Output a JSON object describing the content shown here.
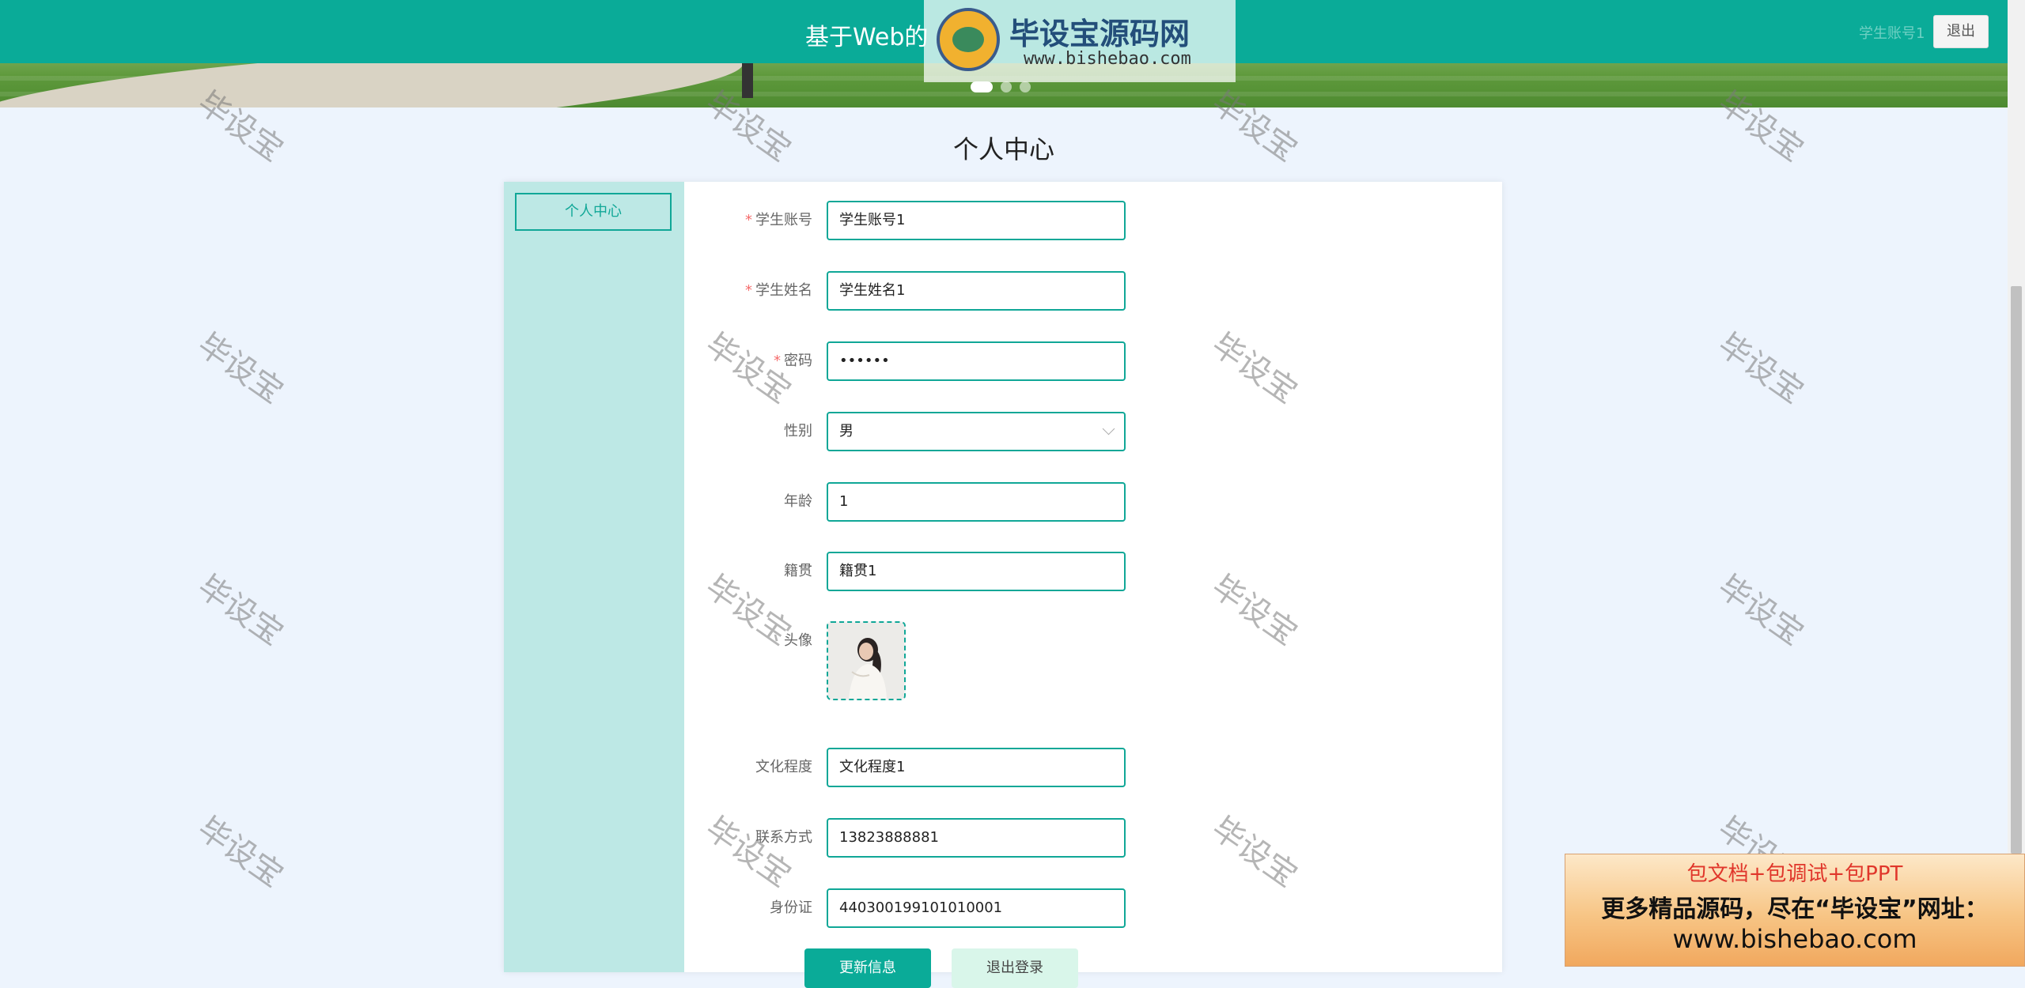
{
  "header": {
    "site_title": "基于Web的",
    "user_label": "学生账号1",
    "logout_label": "退出"
  },
  "logo_watermark": {
    "name": "毕设宝源码网",
    "url": "www.bishebao.com"
  },
  "page": {
    "title": "个人中心"
  },
  "sidebar": {
    "items": [
      {
        "label": "个人中心"
      }
    ]
  },
  "form": {
    "account": {
      "label": "学生账号",
      "value": "学生账号1",
      "required": true
    },
    "name": {
      "label": "学生姓名",
      "value": "学生姓名1",
      "required": true
    },
    "password": {
      "label": "密码",
      "value": "••••••",
      "required": true
    },
    "gender": {
      "label": "性别",
      "value": "男"
    },
    "age": {
      "label": "年龄",
      "value": "1"
    },
    "hometown": {
      "label": "籍贯",
      "value": "籍贯1"
    },
    "avatar": {
      "label": "头像"
    },
    "education": {
      "label": "文化程度",
      "value": "文化程度1"
    },
    "contact": {
      "label": "联系方式",
      "value": "13823888881"
    },
    "id_card": {
      "label": "身份证",
      "value": "440300199101010001"
    }
  },
  "buttons": {
    "update": "更新信息",
    "logout": "退出登录"
  },
  "carousel": {
    "count": 3,
    "active_index": 0
  },
  "watermark_text": "毕设宝",
  "ad": {
    "line1": "包文档+包调试+包PPT",
    "line2": "更多精品源码，尽在“毕设宝”网址：",
    "line3": "www.bishebao.com"
  },
  "colors": {
    "accent": "#0aab98",
    "sidebar_bg": "#bde8e5",
    "page_bg": "#edf4fd",
    "required": "#f56c6c"
  }
}
